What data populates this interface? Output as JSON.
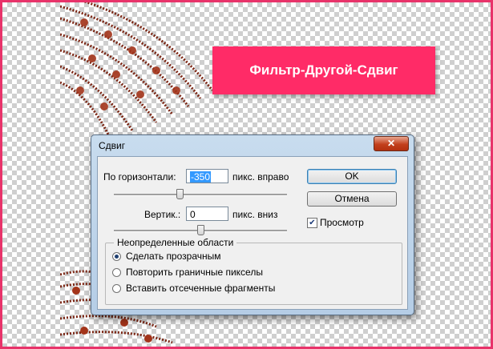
{
  "banner": {
    "text": "Фильтр-Другой-Сдвиг"
  },
  "dialog": {
    "title": "Сдвиг",
    "close_glyph": "✕",
    "horizontal": {
      "label": "По горизонтали:",
      "value": "-350",
      "unit": "пикс. вправо",
      "slider_position": 0.38
    },
    "vertical": {
      "label": "Вертик.:",
      "value": "0",
      "unit": "пикс. вниз",
      "slider_position": 0.5
    },
    "ok_label": "OK",
    "cancel_label": "Отмена",
    "preview": {
      "label": "Просмотр",
      "checked": true
    },
    "undefined_areas": {
      "legend": "Неопределенные области",
      "options": [
        {
          "label": "Сделать прозрачным",
          "selected": true
        },
        {
          "label": "Повторить граничные пикселы",
          "selected": false
        },
        {
          "label": "Вставить отсеченные фрагменты",
          "selected": false
        }
      ]
    }
  },
  "colors": {
    "frame": "#e8336a",
    "banner": "#ff2b67",
    "lace": "#8b2a16"
  }
}
